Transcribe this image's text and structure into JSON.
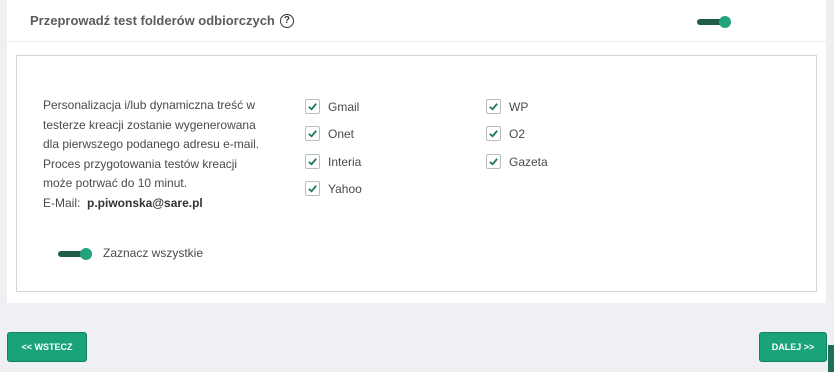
{
  "header": {
    "title": "Przeprowadź test folderów odbiorczych",
    "help_glyph": "?",
    "toggle_on": true
  },
  "description": {
    "lines": [
      "Personalizacja i/lub dynamiczna treść w",
      "testerze kreacji zostanie wygenerowana",
      "dla pierwszego podanego adresu e-mail.",
      "Proces przygotowania testów kreacji",
      "może potrwać do 10 minut."
    ],
    "email_label": "E-Mail:",
    "email_value": "p.piwonska@sare.pl"
  },
  "providers": [
    {
      "label": "Gmail",
      "checked": true
    },
    {
      "label": "Onet",
      "checked": true
    },
    {
      "label": "Interia",
      "checked": true
    },
    {
      "label": "Yahoo",
      "checked": true
    },
    {
      "label": "WP",
      "checked": true
    },
    {
      "label": "O2",
      "checked": true
    },
    {
      "label": "Gazeta",
      "checked": true
    }
  ],
  "select_all": {
    "label": "Zaznacz wszystkie",
    "on": true
  },
  "nav": {
    "back_label": "<< WSTECZ",
    "next_label": "DALEJ >>"
  },
  "colors": {
    "accent": "#1aa37a",
    "toggle_track": "#1f5c49",
    "check": "#1f7a5f"
  }
}
